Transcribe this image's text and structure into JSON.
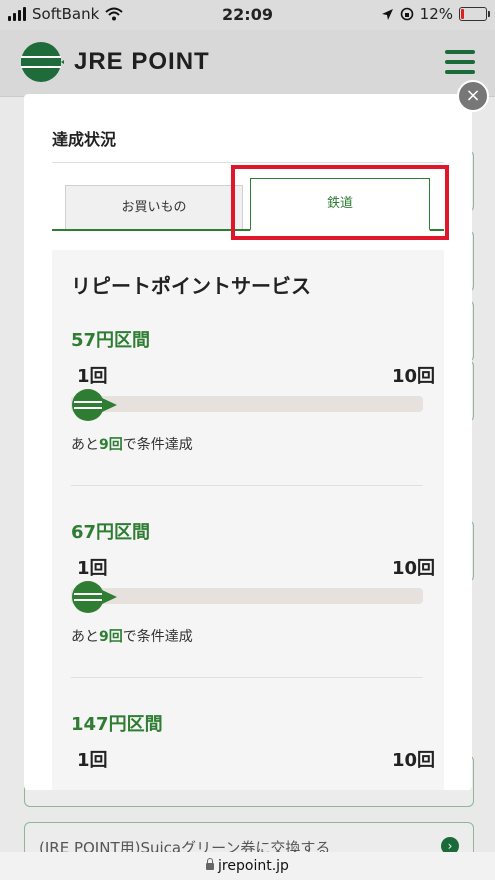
{
  "status_bar": {
    "carrier": "SoftBank",
    "time": "22:09",
    "battery": "12%",
    "battery_level": 0.12
  },
  "header": {
    "logo_text": "JRE POINT",
    "logo_badge": "JRE POINT"
  },
  "background": {
    "bottom_button_label": "(JRE POINT用)Suicaグリーン券に交換する"
  },
  "url": "jrepoint.jp",
  "modal": {
    "title": "達成状況",
    "tabs": [
      {
        "label": "お買いもの",
        "active": false
      },
      {
        "label": "鉄道",
        "active": true
      }
    ],
    "panel": {
      "title": "リピートポイントサービス",
      "sections": [
        {
          "name": "57円区間",
          "min_label": "1回",
          "max_label": "10回",
          "progress": 0.0,
          "remaining_prefix": "あと",
          "remaining_value": "9回",
          "remaining_suffix": "で条件達成"
        },
        {
          "name": "67円区間",
          "min_label": "1回",
          "max_label": "10回",
          "progress": 0.0,
          "remaining_prefix": "あと",
          "remaining_value": "9回",
          "remaining_suffix": "で条件達成"
        },
        {
          "name": "147円区間",
          "min_label": "1回",
          "max_label": "10回",
          "progress": 0.0,
          "remaining_prefix": "",
          "remaining_value": "",
          "remaining_suffix": ""
        }
      ]
    }
  },
  "colors": {
    "brand_green": "#2e7d32",
    "highlight_red": "#e0162b",
    "track": "#e6e1dc"
  }
}
